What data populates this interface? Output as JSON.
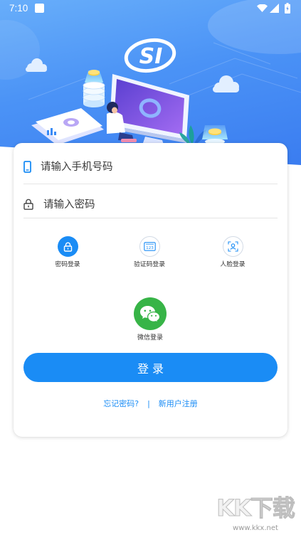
{
  "status_bar": {
    "time": "7:10",
    "icons": [
      "notification-icon",
      "wifi-icon",
      "signal-icon",
      "battery-icon"
    ]
  },
  "header": {
    "logo_text": "SI"
  },
  "login_form": {
    "phone_input": {
      "placeholder": "请输入手机号码",
      "icon": "phone-icon"
    },
    "password_input": {
      "placeholder": "请输入密码",
      "icon": "lock-icon"
    }
  },
  "login_methods": [
    {
      "label": "密码登录",
      "icon": "lock-icon",
      "selected": true
    },
    {
      "label": "验证码登录",
      "icon": "sms-code-icon",
      "icon_text": "123",
      "selected": false
    },
    {
      "label": "人脸登录",
      "icon": "face-scan-icon",
      "selected": false
    }
  ],
  "wechat_login": {
    "label": "微信登录",
    "icon": "wechat-icon"
  },
  "submit_button": {
    "label": "登 录"
  },
  "links": {
    "forgot_password": "忘记密码?",
    "separator": "|",
    "register": "新用户注册"
  },
  "watermark": {
    "brand": "KK下载",
    "url": "www.kkx.net"
  },
  "colors": {
    "primary": "#1a8cf5",
    "wechat_green": "#37b447",
    "header_blue_light": "#68aefa",
    "header_blue_dark": "#3a7cf0",
    "text": "#333333",
    "divider": "#e5e5e5"
  }
}
